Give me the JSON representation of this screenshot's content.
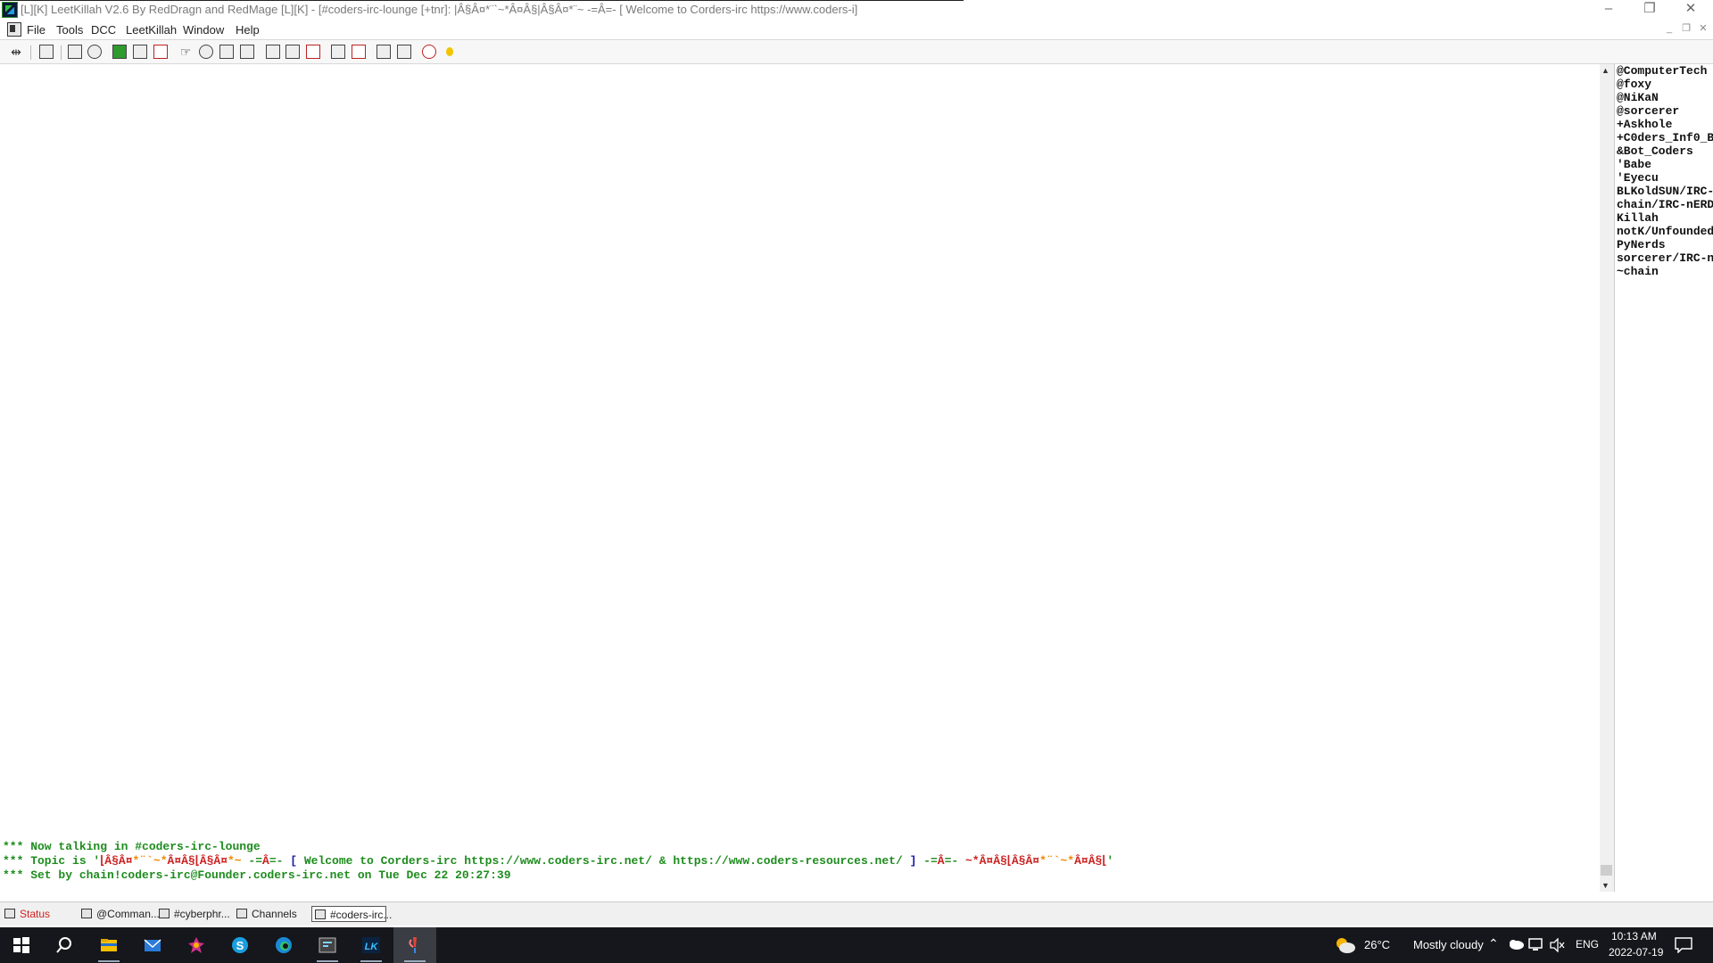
{
  "window": {
    "title": "[L][K] LeetKillah V2.6 By RedDragn and RedMage [L][K] - [#coders-irc-lounge [+tnr]: |Â§Â¤*¨`~*Â¤Â§|Â§Â¤*¨~ -=Â=- [ Welcome to Corders-irc https://www.coders-i]",
    "controls": {
      "minimize": "–",
      "restore": "❐",
      "close": "✕"
    }
  },
  "menu": [
    "File",
    "Tools",
    "DCC",
    "LeetKillah",
    "Window",
    "Help"
  ],
  "mdi_controls": {
    "minimize": "_",
    "restore": "❐",
    "close": "✕"
  },
  "toolbar": {
    "icons": [
      "connect-icon",
      "options-icon",
      "address-book-icon",
      "url-list-icon",
      "script-editor-icon",
      "colors-icon",
      "remote-icon",
      "send-icon",
      "ping-icon",
      "channel-list-icon",
      "notify-icon",
      "tile-window-icon",
      "cascade-window-icon",
      "close-window-icon",
      "dcc-send-icon",
      "dcc-chat-icon",
      "split-horizontal-icon",
      "split-vertical-icon",
      "help-icon",
      "user-icon"
    ]
  },
  "chat": {
    "line1": "*** Now talking in #coders-irc-lounge",
    "line2_prefix": "*** Topic is '",
    "line2_red1": "⌊Â§Â¤",
    "line2_orange1": "*¨`~*",
    "line2_red2": "Â¤Â§⌊Â§Â¤",
    "line2_orange2": "*~",
    "line2_mid1": " -=",
    "line2_red3": "Â",
    "line2_mid2": "=- ",
    "line2_bracket_open": "[",
    "line2_welcome": " Welcome to Corders-irc https://www.coders-irc.net/ & https://www.coders-resources.net/ ",
    "line2_bracket_close": "]",
    "line2_mid3": " -=",
    "line2_red4": "Â",
    "line2_mid4": "=- ",
    "line2_red5": "~*Â¤Â§⌊Â§Â¤",
    "line2_orange3": "*¨`~*",
    "line2_red6": "Â¤Â§⌊",
    "line2_suffix": "'",
    "line3": "*** Set by chain!coders-irc@Founder.coders-irc.net on Tue Dec 22 20:27:39"
  },
  "nicklist": [
    "@ComputerTech",
    "@foxy",
    "@NiKaN",
    "@sorcerer",
    "+Askhole",
    "+C0ders_Inf0_B",
    "&Bot_Coders",
    "'Babe",
    "'Eyecu",
    "BLKoldSUN/IRC-",
    "chain/IRC-nERD",
    "Killah",
    "notK/Unfounded",
    "PyNerds",
    "sorcerer/IRC-n",
    "~chain"
  ],
  "switchbar": [
    {
      "label": "Status",
      "type": "status"
    },
    {
      "label": "@Comman...",
      "type": "normal"
    },
    {
      "label": "#cyberphr...",
      "type": "normal"
    },
    {
      "label": "Channels",
      "type": "normal"
    },
    {
      "label": "#coders-irc...",
      "type": "active"
    }
  ],
  "taskbar": {
    "apps": [
      "start-icon",
      "search-icon",
      "file-explorer-icon",
      "mail-icon",
      "app-star-icon",
      "skype-icon",
      "edge-icon",
      "terminal-icon",
      "leetkillah-icon",
      "irc-active-icon"
    ],
    "weather_temp": "26°C",
    "weather_desc": "Mostly cloudy",
    "lang": "ENG",
    "time": "10:13 AM",
    "date": "2022-07-19"
  }
}
